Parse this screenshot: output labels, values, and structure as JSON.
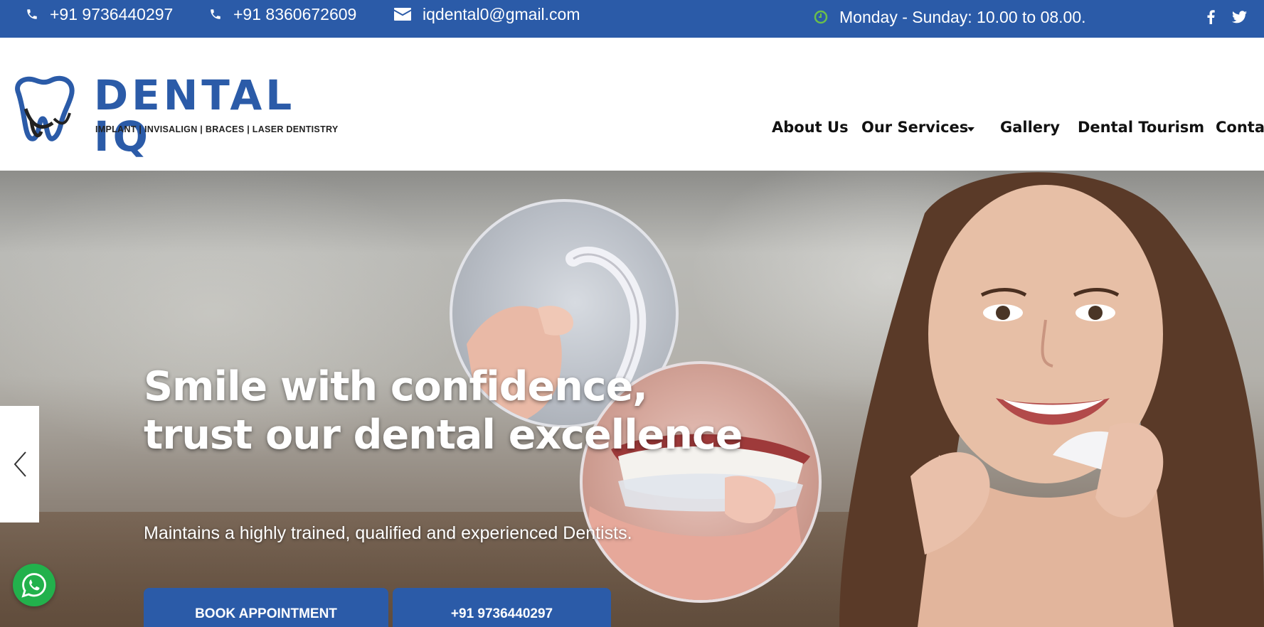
{
  "topbar": {
    "phone1": "+91 9736440297",
    "phone2": "+91 8360672609",
    "email": "iqdental0@gmail.com",
    "hours": "Monday - Sunday: 10.00 to 08.00.",
    "icons": [
      "phone-icon",
      "phone-icon",
      "envelope-icon",
      "clock-icon",
      "facebook-icon",
      "twitter-icon"
    ]
  },
  "logo": {
    "title": "DENTAL IQ",
    "tagline": "IMPLANT | INVISALIGN | BRACES | LASER DENTISTRY"
  },
  "nav": {
    "items": [
      "About Us",
      "Our Services",
      "Gallery",
      "Dental Tourism",
      "Contact"
    ]
  },
  "hero": {
    "title_line1": "Smile with confidence,",
    "title_line2": "trust our dental excellence",
    "subtitle": "Maintains a highly trained, qualified and experienced Dentists.",
    "book_button": "BOOK APPOINTMENT",
    "call_button": "+91 9736440297"
  },
  "colors": {
    "brand_blue": "#2b5ba8",
    "clock_green": "#6abf4b",
    "whatsapp_green": "#22b14c"
  }
}
